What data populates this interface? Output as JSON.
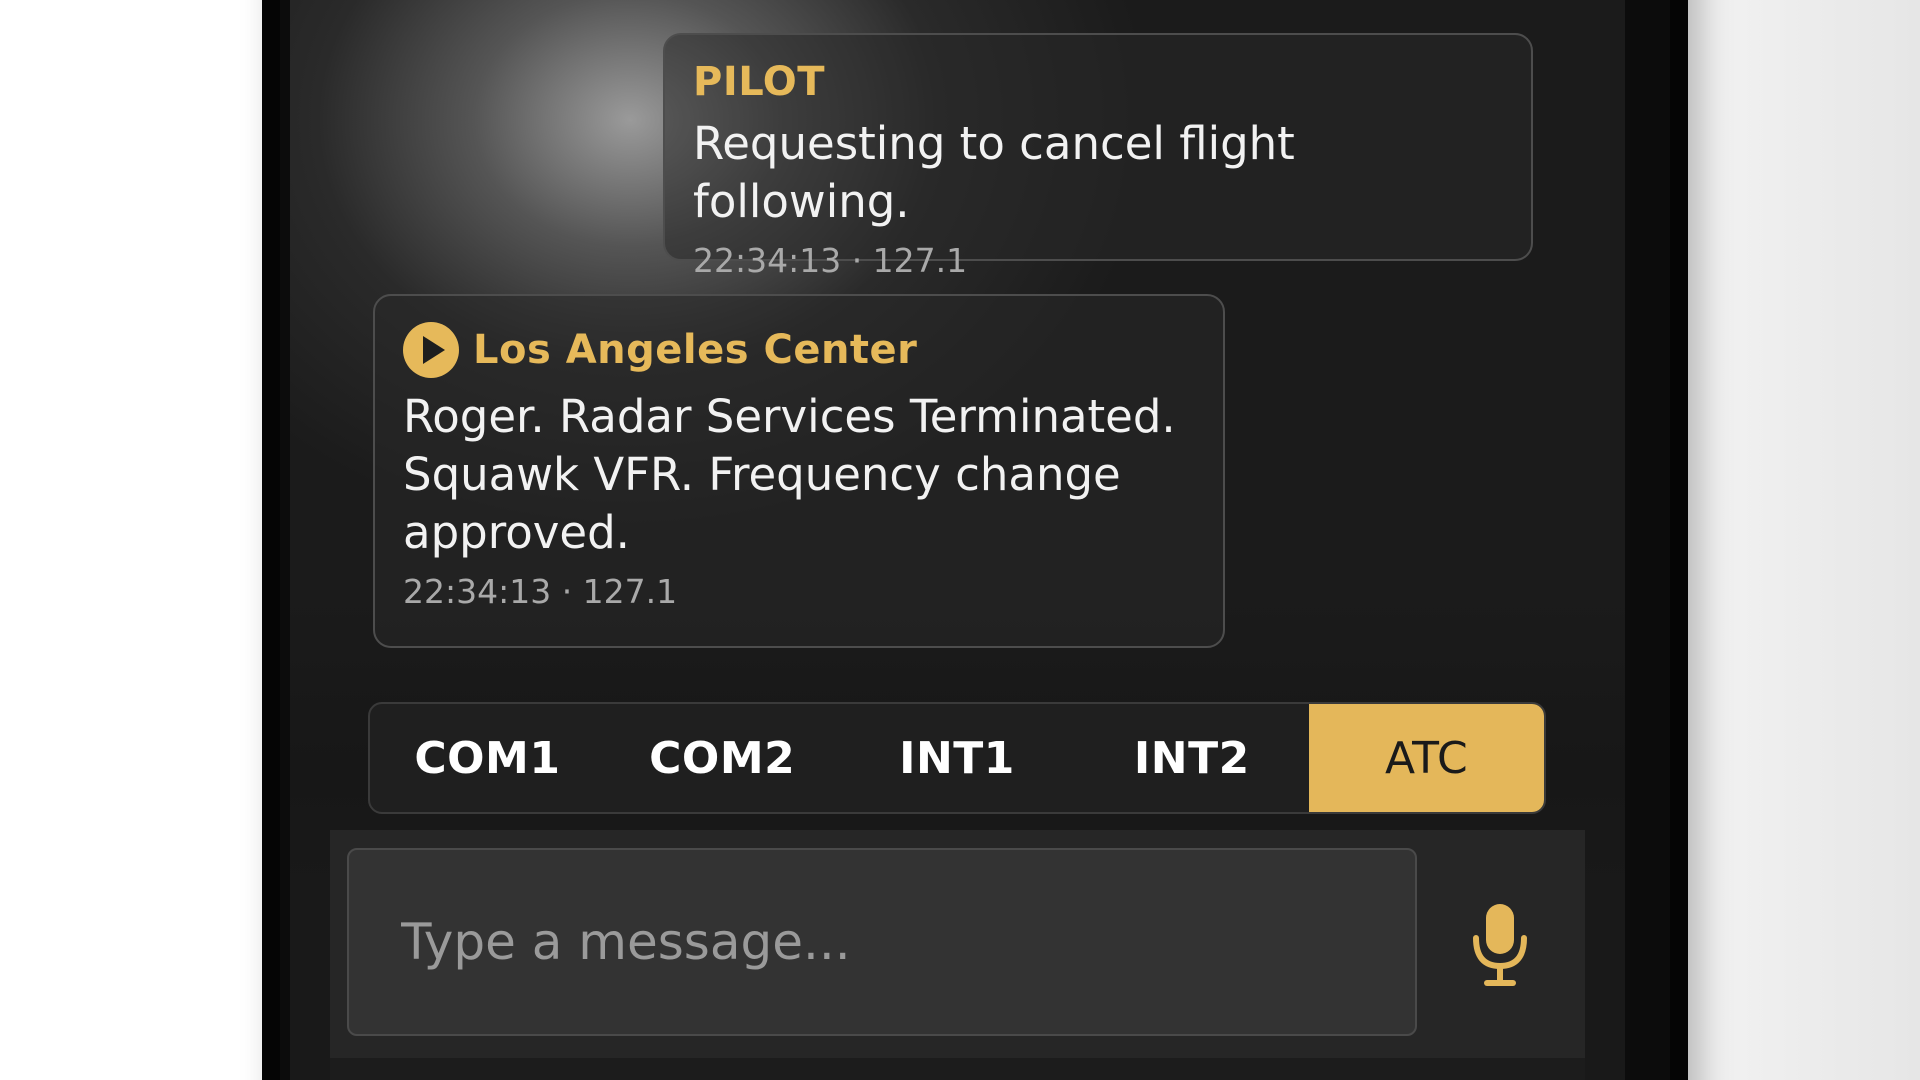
{
  "messages": [
    {
      "role": "pilot",
      "sender": "PILOT",
      "text": "Requesting to cancel flight following.",
      "meta": "22:34:13 · 127.1"
    },
    {
      "role": "atc",
      "sender": "Los Angeles Center",
      "text": "Roger. Radar Services Terminated. Squawk VFR. Frequency change approved.",
      "meta": "22:34:13 · 127.1",
      "icon": "play-icon"
    }
  ],
  "channels": {
    "tabs": [
      {
        "label": "COM1",
        "active": false
      },
      {
        "label": "COM2",
        "active": false
      },
      {
        "label": "INT1",
        "active": false
      },
      {
        "label": "INT2",
        "active": false
      },
      {
        "label": "ATC",
        "active": true
      }
    ]
  },
  "composer": {
    "placeholder": "Type a message...",
    "value": "",
    "mic_icon": "microphone-icon"
  },
  "colors": {
    "accent": "#e4b75a",
    "bubble_border": "#4d4d4d",
    "background": "#1b1b1b"
  }
}
